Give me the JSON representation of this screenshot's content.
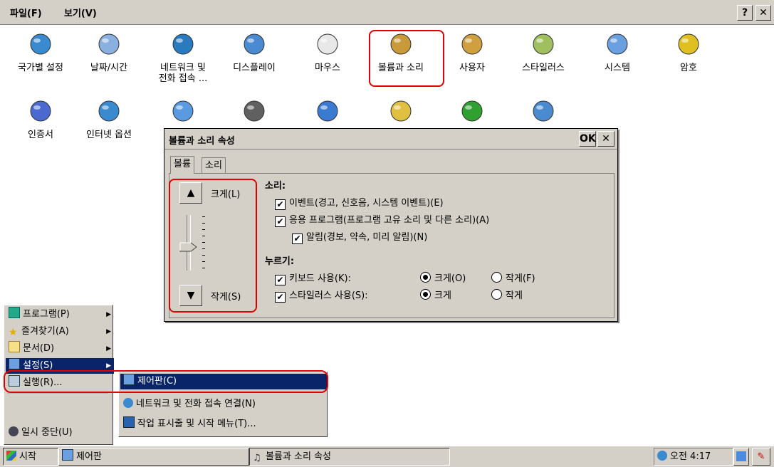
{
  "menubar": {
    "file": "파일(F)",
    "view": "보기(V)",
    "help": "?",
    "close": "✕"
  },
  "icons_row1": [
    {
      "label": "국가별 설정",
      "icon": "globe-calendar-icon"
    },
    {
      "label": "날짜/시간",
      "icon": "clock-calendar-icon"
    },
    {
      "label": "네트워크 및\n전화 접속 ...",
      "icon": "network-globe-icon"
    },
    {
      "label": "디스플레이",
      "icon": "display-icon"
    },
    {
      "label": "마우스",
      "icon": "mouse-icon"
    },
    {
      "label": "볼륨과 소리",
      "icon": "volume-sound-icon"
    },
    {
      "label": "사용자",
      "icon": "users-icon"
    },
    {
      "label": "스타일러스",
      "icon": "stylus-icon"
    },
    {
      "label": "시스템",
      "icon": "system-icon"
    },
    {
      "label": "암호",
      "icon": "password-key-icon"
    }
  ],
  "icons_row2": [
    {
      "label": "인증서",
      "icon": "certificate-gear-icon"
    },
    {
      "label": "인터넷 옵션",
      "icon": "internet-options-icon"
    },
    {
      "label": "",
      "icon": "keyboard-monitor-icon"
    },
    {
      "label": "",
      "icon": "phone-icon"
    },
    {
      "label": "",
      "icon": "input-panel-icon"
    },
    {
      "label": "",
      "icon": "network-people-icon"
    },
    {
      "label": "",
      "icon": "windows-flag-icon"
    },
    {
      "label": "",
      "icon": "network-computers-icon"
    }
  ],
  "dialog": {
    "title": "볼륨과 소리 속성",
    "ok": "OK",
    "close": "✕",
    "tabs": [
      "볼륨",
      "소리"
    ],
    "louder": "크게(L)",
    "softer": "작게(S)",
    "sounds_heading": "소리:",
    "events": "이벤트(경고, 신호음, 시스템 이벤트)(E)",
    "apps": "응용 프로그램(프로그램 고유 소리 및 다른 소리)(A)",
    "notifications": "알림(경보, 약속, 미리 알림)(N)",
    "clicks_heading": "누르기:",
    "keyboard": "키보드 사용(K):",
    "keyboard_loud": "크게(O)",
    "keyboard_soft": "작게(F)",
    "stylus": "스타일러스 사용(S):",
    "stylus_loud": "크게",
    "stylus_soft": "작게",
    "volume_level": 0.42
  },
  "start_menu": {
    "items": [
      "프로그램(P)",
      "즐겨찾기(A)",
      "문서(D)",
      "설정(S)",
      "실행(R)...",
      "일시 중단(U)"
    ]
  },
  "submenu": {
    "items": [
      "제어판(C)",
      "네트워크 및 전화 접속 연결(N)",
      "작업 표시줄 및 시작 메뉴(T)..."
    ]
  },
  "taskbar": {
    "start": "시작",
    "control_panel": "제어판",
    "volume_props": "볼륨과 소리 속성",
    "clock": "오전 4:17"
  },
  "colors": {
    "highlight": "#0a246a",
    "red_outline": "#e00000",
    "face": "#d4d0c8"
  }
}
